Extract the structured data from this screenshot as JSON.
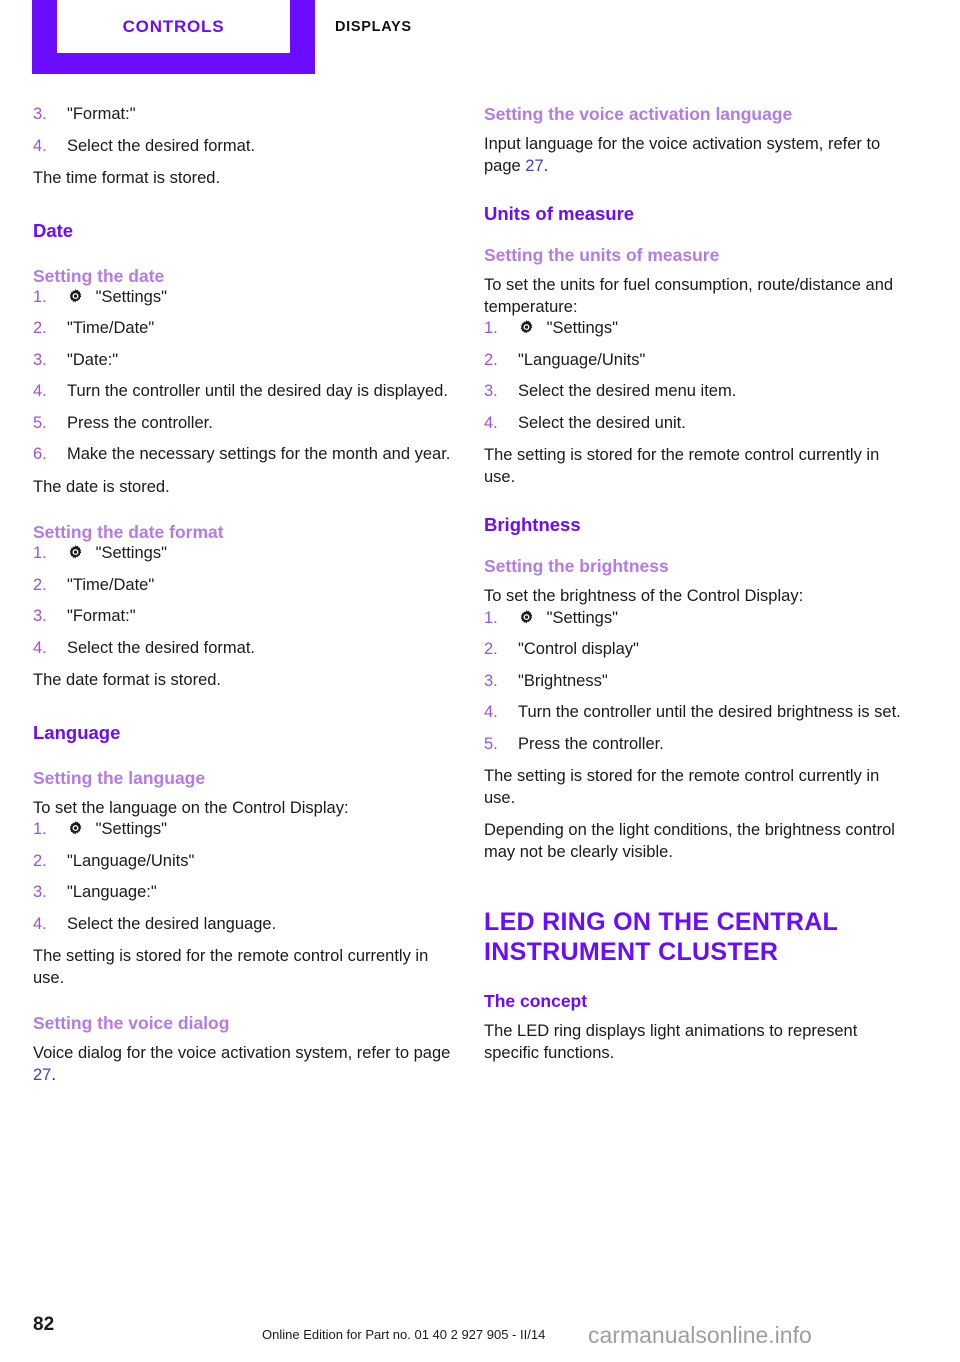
{
  "header": {
    "active_tab": "CONTROLS",
    "inactive_tab": "DISPLAYS"
  },
  "icons": {
    "settings": "gear-icon"
  },
  "colors": {
    "brand_purple": "#6a0dff",
    "subheading_purple": "#b47be8",
    "list_number_purple": "#9b51e0",
    "page_reference_blue": "#3b3bd6",
    "watermark_gray": "#9e9e9e"
  },
  "left_column": {
    "steps_time_format": [
      {
        "num": "3.",
        "text": "\"Format:\""
      },
      {
        "num": "4.",
        "text": "Select the desired format."
      }
    ],
    "time_format_stored": "The time format is stored.",
    "date_heading": "Date",
    "setting_the_date_heading": "Setting the date",
    "steps_setting_date": [
      {
        "num": "1.",
        "icon": "gear-icon",
        "text": "\"Settings\""
      },
      {
        "num": "2.",
        "text": "\"Time/Date\""
      },
      {
        "num": "3.",
        "text": "\"Date:\""
      },
      {
        "num": "4.",
        "text": "Turn the controller until the desired day is displayed."
      },
      {
        "num": "5.",
        "text": "Press the controller."
      },
      {
        "num": "6.",
        "text": "Make the necessary settings for the month and year."
      }
    ],
    "date_stored": "The date is stored.",
    "setting_the_date_format_heading": "Setting the date format",
    "steps_date_format": [
      {
        "num": "1.",
        "icon": "gear-icon",
        "text": "\"Settings\""
      },
      {
        "num": "2.",
        "text": "\"Time/Date\""
      },
      {
        "num": "3.",
        "text": "\"Format:\""
      },
      {
        "num": "4.",
        "text": "Select the desired format."
      }
    ],
    "date_format_stored": "The date format is stored.",
    "language_heading": "Language",
    "setting_the_language_heading": "Setting the language",
    "language_intro": "To set the language on the Control Display:",
    "steps_language": [
      {
        "num": "1.",
        "icon": "gear-icon",
        "text": "\"Settings\""
      },
      {
        "num": "2.",
        "text": "\"Language/Units\""
      },
      {
        "num": "3.",
        "text": "\"Language:\""
      },
      {
        "num": "4.",
        "text": "Select the desired language."
      }
    ],
    "language_stored": "The setting is stored for the remote control currently in use.",
    "setting_the_voice_dialog_heading": "Setting the voice dialog",
    "voice_dialog_text_before": "Voice dialog for the voice activation system, refer to page ",
    "voice_dialog_page_ref": "27",
    "voice_dialog_text_after": "."
  },
  "right_column": {
    "setting_the_voice_activation_language_heading": "Setting the voice activation language",
    "voice_activation_text_before": "Input language for the voice activation system, refer to page ",
    "voice_activation_page_ref": "27",
    "voice_activation_text_after": ".",
    "units_of_measure_heading": "Units of measure",
    "setting_the_units_heading": "Setting the units of measure",
    "units_intro": "To set the units for fuel consumption, route/distance and temperature:",
    "steps_units": [
      {
        "num": "1.",
        "icon": "gear-icon",
        "text": "\"Settings\""
      },
      {
        "num": "2.",
        "text": "\"Language/Units\""
      },
      {
        "num": "3.",
        "text": "Select the desired menu item."
      },
      {
        "num": "4.",
        "text": "Select the desired unit."
      }
    ],
    "units_stored": "The setting is stored for the remote control currently in use.",
    "brightness_heading": "Brightness",
    "setting_the_brightness_heading": "Setting the brightness",
    "brightness_intro": "To set the brightness of the Control Display:",
    "steps_brightness": [
      {
        "num": "1.",
        "icon": "gear-icon",
        "text": "\"Settings\""
      },
      {
        "num": "2.",
        "text": "\"Control display\""
      },
      {
        "num": "3.",
        "text": "\"Brightness\""
      },
      {
        "num": "4.",
        "text": "Turn the controller until the desired brightness is set."
      },
      {
        "num": "5.",
        "text": "Press the controller."
      }
    ],
    "brightness_stored": "The setting is stored for the remote control currently in use.",
    "brightness_note": "Depending on the light conditions, the brightness control may not be clearly visible.",
    "led_ring_title": "LED RING ON THE CENTRAL INSTRUMENT CLUSTER",
    "the_concept_heading": "The concept",
    "concept_text": "The LED ring displays light animations to represent specific functions."
  },
  "footer": {
    "page_number": "82",
    "edition_note": "Online Edition for Part no. 01 40 2 927 905 - II/14",
    "watermark": "carmanualsonline.info"
  }
}
